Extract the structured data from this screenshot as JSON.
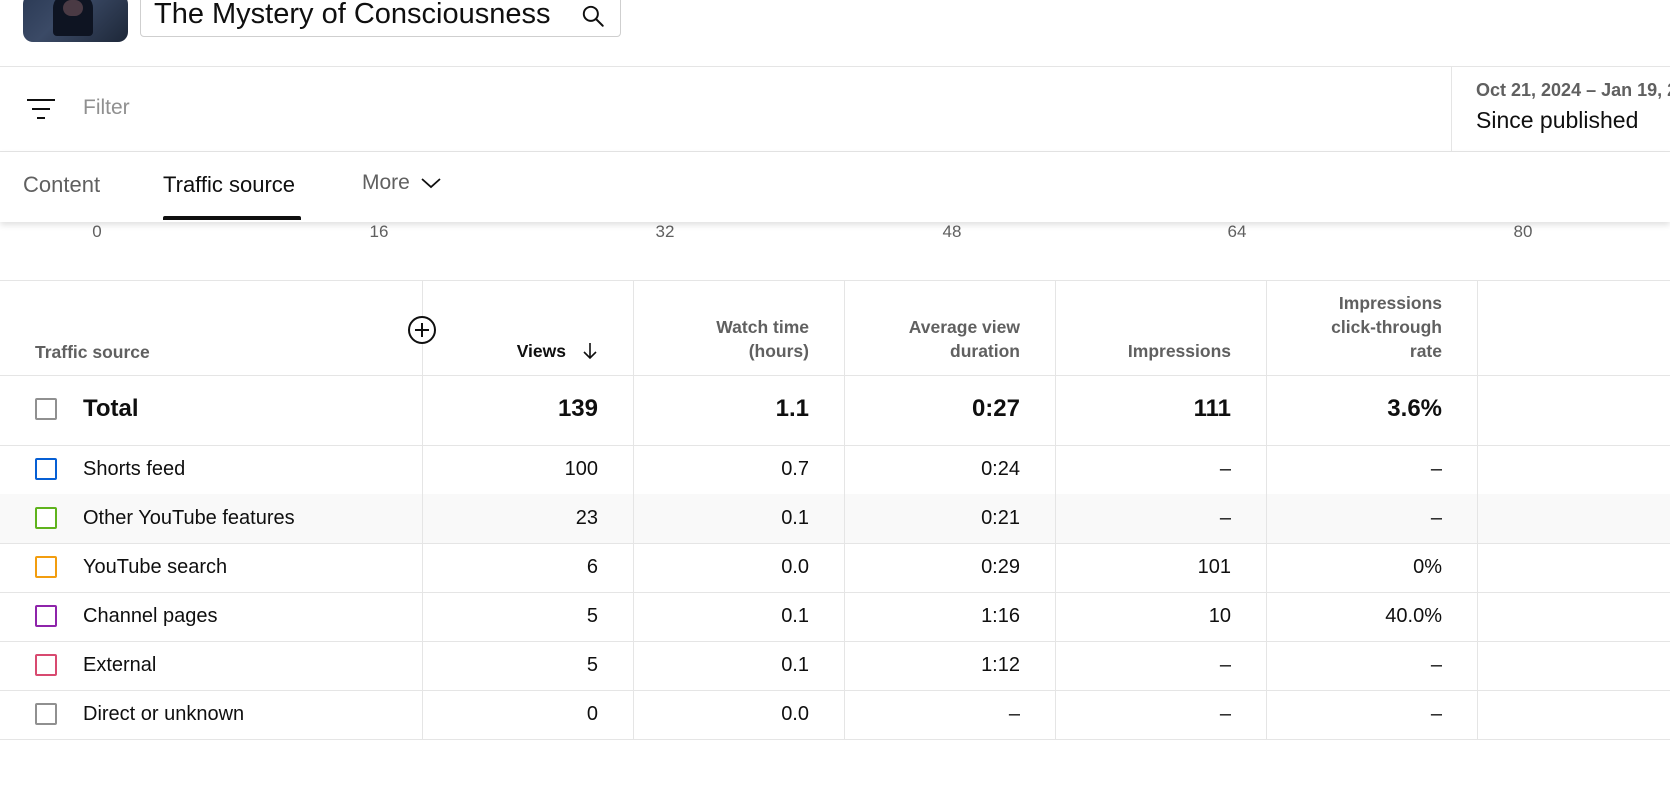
{
  "header": {
    "video_title": "The Mystery of Consciousness"
  },
  "filterbar": {
    "placeholder": "Filter",
    "date_range": "Oct 21, 2024 – Jan 19, 2",
    "date_label": "Since published"
  },
  "tabs": {
    "items": [
      "Content",
      "Traffic source",
      "More"
    ],
    "active": "Traffic source"
  },
  "axis": {
    "ticks": [
      "0",
      "16",
      "32",
      "48",
      "64",
      "80"
    ]
  },
  "table": {
    "headers": {
      "source": "Traffic source",
      "views": "Views",
      "watch_time": [
        "Watch time",
        "(hours)"
      ],
      "avg_duration": [
        "Average view",
        "duration"
      ],
      "impressions": "Impressions",
      "ctr": [
        "Impressions",
        "click-through",
        "rate"
      ]
    },
    "total": {
      "label": "Total",
      "views": "139",
      "watch_time": "1.1",
      "avg_duration": "0:27",
      "impressions": "111",
      "ctr": "3.6%"
    },
    "rows": [
      {
        "label": "Shorts feed",
        "color": "#065fd4",
        "views": "100",
        "watch_time": "0.7",
        "avg_duration": "0:24",
        "impressions": "–",
        "ctr": "–"
      },
      {
        "label": "Other YouTube features",
        "color": "#5fb31d",
        "views": "23",
        "watch_time": "0.1",
        "avg_duration": "0:21",
        "impressions": "–",
        "ctr": "–"
      },
      {
        "label": "YouTube search",
        "color": "#f29d0f",
        "views": "6",
        "watch_time": "0.0",
        "avg_duration": "0:29",
        "impressions": "101",
        "ctr": "0%"
      },
      {
        "label": "Channel pages",
        "color": "#8e24aa",
        "views": "5",
        "watch_time": "0.1",
        "avg_duration": "1:16",
        "impressions": "10",
        "ctr": "40.0%"
      },
      {
        "label": "External",
        "color": "#d84a70",
        "views": "5",
        "watch_time": "0.1",
        "avg_duration": "1:12",
        "impressions": "–",
        "ctr": "–"
      },
      {
        "label": "Direct or unknown",
        "color": "#909090",
        "views": "0",
        "watch_time": "0.0",
        "avg_duration": "–",
        "impressions": "–",
        "ctr": "–"
      }
    ]
  }
}
